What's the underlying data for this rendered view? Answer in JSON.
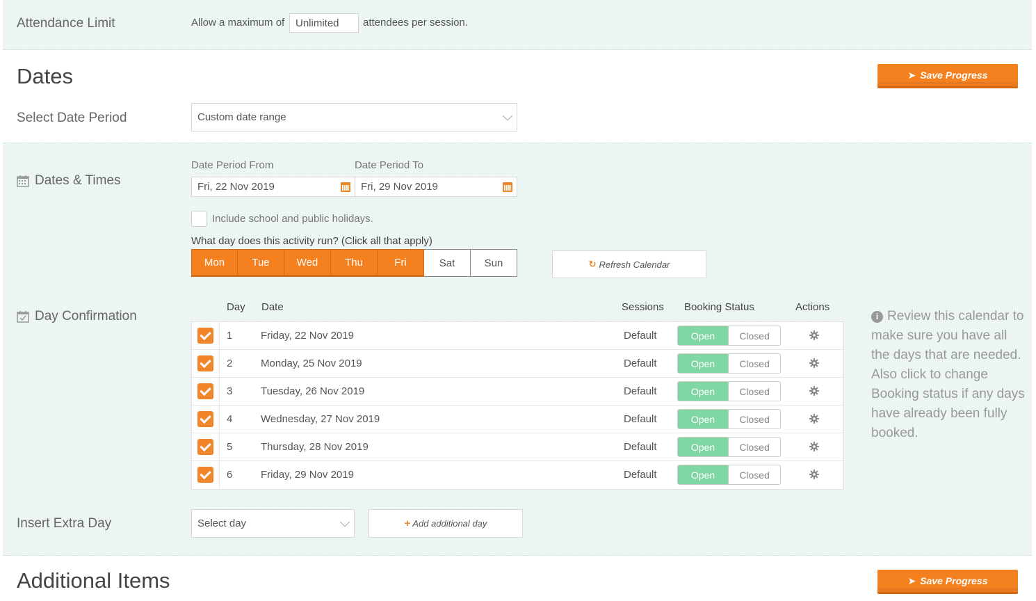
{
  "attendance": {
    "label": "Attendance Limit",
    "prefix": "Allow a maximum of",
    "value": "Unlimited",
    "suffix": "attendees per session."
  },
  "dates": {
    "title": "Dates",
    "save_label": "Save Progress",
    "select_period_label": "Select Date Period",
    "select_period_value": "Custom date range"
  },
  "dates_times": {
    "label": "Dates & Times",
    "from_label": "Date Period From",
    "from_value": "Fri, 22 Nov 2019",
    "to_label": "Date Period To",
    "to_value": "Fri, 29 Nov 2019",
    "holidays_label": "Include school and public holidays.",
    "days_question": "What day does this activity run? (Click all that apply)",
    "days": [
      {
        "label": "Mon",
        "selected": true
      },
      {
        "label": "Tue",
        "selected": true
      },
      {
        "label": "Wed",
        "selected": true
      },
      {
        "label": "Thu",
        "selected": true
      },
      {
        "label": "Fri",
        "selected": true
      },
      {
        "label": "Sat",
        "selected": false
      },
      {
        "label": "Sun",
        "selected": false
      }
    ],
    "refresh_label": "Refresh Calendar"
  },
  "confirmation": {
    "label": "Day Confirmation",
    "headers": {
      "day": "Day",
      "date": "Date",
      "sessions": "Sessions",
      "status": "Booking Status",
      "actions": "Actions"
    },
    "rows": [
      {
        "day": "1",
        "date": "Friday, 22 Nov 2019",
        "sessions": "Default",
        "open": "Open",
        "closed": "Closed"
      },
      {
        "day": "2",
        "date": "Monday, 25 Nov 2019",
        "sessions": "Default",
        "open": "Open",
        "closed": "Closed"
      },
      {
        "day": "3",
        "date": "Tuesday, 26 Nov 2019",
        "sessions": "Default",
        "open": "Open",
        "closed": "Closed"
      },
      {
        "day": "4",
        "date": "Wednesday, 27 Nov 2019",
        "sessions": "Default",
        "open": "Open",
        "closed": "Closed"
      },
      {
        "day": "5",
        "date": "Thursday, 28 Nov 2019",
        "sessions": "Default",
        "open": "Open",
        "closed": "Closed"
      },
      {
        "day": "6",
        "date": "Friday, 29 Nov 2019",
        "sessions": "Default",
        "open": "Open",
        "closed": "Closed"
      }
    ],
    "info": "Review this calendar to make sure you have all the days that are needed. Also click to change Booking status if any days have already been fully booked."
  },
  "extra_day": {
    "label": "Insert Extra Day",
    "select_value": "Select day",
    "add_label": "Add additional day"
  },
  "additional": {
    "title": "Additional Items",
    "save_label": "Save Progress"
  },
  "colors": {
    "accent": "#f58020",
    "open": "#7ed7a4",
    "band": "#eef7f6"
  }
}
